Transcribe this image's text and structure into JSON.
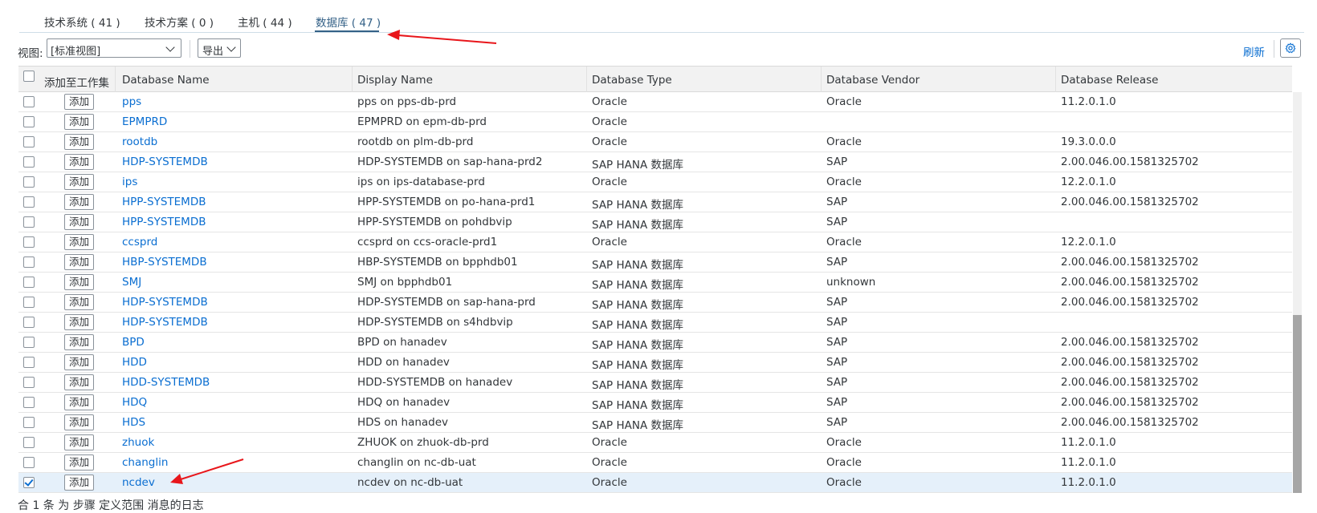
{
  "tabs": [
    {
      "label": "技术系统 ( 41 )"
    },
    {
      "label": "技术方案 ( 0 )"
    },
    {
      "label": "主机 ( 44 )"
    },
    {
      "label": "数据库 ( 47 )",
      "active": true
    }
  ],
  "toolbar": {
    "view_label": "视图:",
    "view_value": "[标准视图]",
    "export_label": "导出",
    "refresh_label": "刷新",
    "settings_icon": "gear-icon"
  },
  "table": {
    "columns": [
      "添加至工作集",
      "Database Name",
      "Display Name",
      "Database Type",
      "Database Vendor",
      "Database Release"
    ],
    "add_label": "添加",
    "rows": [
      {
        "checked": false,
        "name": "pps",
        "display": "pps on pps-db-prd",
        "type": "Oracle",
        "vendor": "Oracle",
        "release": "11.2.0.1.0"
      },
      {
        "checked": false,
        "name": "EPMPRD",
        "display": "EPMPRD on epm-db-prd",
        "type": "Oracle",
        "vendor": "",
        "release": ""
      },
      {
        "checked": false,
        "name": "rootdb",
        "display": "rootdb on plm-db-prd",
        "type": "Oracle",
        "vendor": "Oracle",
        "release": "19.3.0.0.0"
      },
      {
        "checked": false,
        "name": "HDP-SYSTEMDB",
        "display": "HDP-SYSTEMDB on sap-hana-prd2",
        "type": "SAP HANA 数据库",
        "vendor": "SAP",
        "release": "2.00.046.00.1581325702"
      },
      {
        "checked": false,
        "name": "ips",
        "display": "ips on ips-database-prd",
        "type": "Oracle",
        "vendor": "Oracle",
        "release": "12.2.0.1.0"
      },
      {
        "checked": false,
        "name": "HPP-SYSTEMDB",
        "display": "HPP-SYSTEMDB on po-hana-prd1",
        "type": "SAP HANA 数据库",
        "vendor": "SAP",
        "release": "2.00.046.00.1581325702"
      },
      {
        "checked": false,
        "name": "HPP-SYSTEMDB",
        "display": "HPP-SYSTEMDB on pohdbvip",
        "type": "SAP HANA 数据库",
        "vendor": "SAP",
        "release": ""
      },
      {
        "checked": false,
        "name": "ccsprd",
        "display": "ccsprd on ccs-oracle-prd1",
        "type": "Oracle",
        "vendor": "Oracle",
        "release": "12.2.0.1.0"
      },
      {
        "checked": false,
        "name": "HBP-SYSTEMDB",
        "display": "HBP-SYSTEMDB on bpphdb01",
        "type": "SAP HANA 数据库",
        "vendor": "SAP",
        "release": "2.00.046.00.1581325702"
      },
      {
        "checked": false,
        "name": "SMJ",
        "display": "SMJ on bpphdb01",
        "type": "SAP HANA 数据库",
        "vendor": "unknown",
        "release": "2.00.046.00.1581325702"
      },
      {
        "checked": false,
        "name": "HDP-SYSTEMDB",
        "display": "HDP-SYSTEMDB on sap-hana-prd",
        "type": "SAP HANA 数据库",
        "vendor": "SAP",
        "release": "2.00.046.00.1581325702"
      },
      {
        "checked": false,
        "name": "HDP-SYSTEMDB",
        "display": "HDP-SYSTEMDB on s4hdbvip",
        "type": "SAP HANA 数据库",
        "vendor": "SAP",
        "release": ""
      },
      {
        "checked": false,
        "name": "BPD",
        "display": "BPD on hanadev",
        "type": "SAP HANA 数据库",
        "vendor": "SAP",
        "release": "2.00.046.00.1581325702"
      },
      {
        "checked": false,
        "name": "HDD",
        "display": "HDD on hanadev",
        "type": "SAP HANA 数据库",
        "vendor": "SAP",
        "release": "2.00.046.00.1581325702"
      },
      {
        "checked": false,
        "name": "HDD-SYSTEMDB",
        "display": "HDD-SYSTEMDB on hanadev",
        "type": "SAP HANA 数据库",
        "vendor": "SAP",
        "release": "2.00.046.00.1581325702"
      },
      {
        "checked": false,
        "name": "HDQ",
        "display": "HDQ on hanadev",
        "type": "SAP HANA 数据库",
        "vendor": "SAP",
        "release": "2.00.046.00.1581325702"
      },
      {
        "checked": false,
        "name": "HDS",
        "display": "HDS on hanadev",
        "type": "SAP HANA 数据库",
        "vendor": "SAP",
        "release": "2.00.046.00.1581325702"
      },
      {
        "checked": false,
        "name": "zhuok",
        "display": "ZHUOK on zhuok-db-prd",
        "type": "Oracle",
        "vendor": "Oracle",
        "release": "11.2.0.1.0"
      },
      {
        "checked": false,
        "name": "changlin",
        "display": "changlin on nc-db-uat",
        "type": "Oracle",
        "vendor": "Oracle",
        "release": "11.2.0.1.0"
      },
      {
        "checked": true,
        "name": "ncdev",
        "display": "ncdev on nc-db-uat",
        "type": "Oracle",
        "vendor": "Oracle",
        "release": "11.2.0.1.0"
      }
    ]
  },
  "footer": {
    "text": "合 1 条 为 步骤 定义范围 消息的日志"
  },
  "colors": {
    "link": "#0a6ed1",
    "tab_active": "#346187",
    "arrow": "#e8161b",
    "selected_row": "#e5f0fa"
  }
}
